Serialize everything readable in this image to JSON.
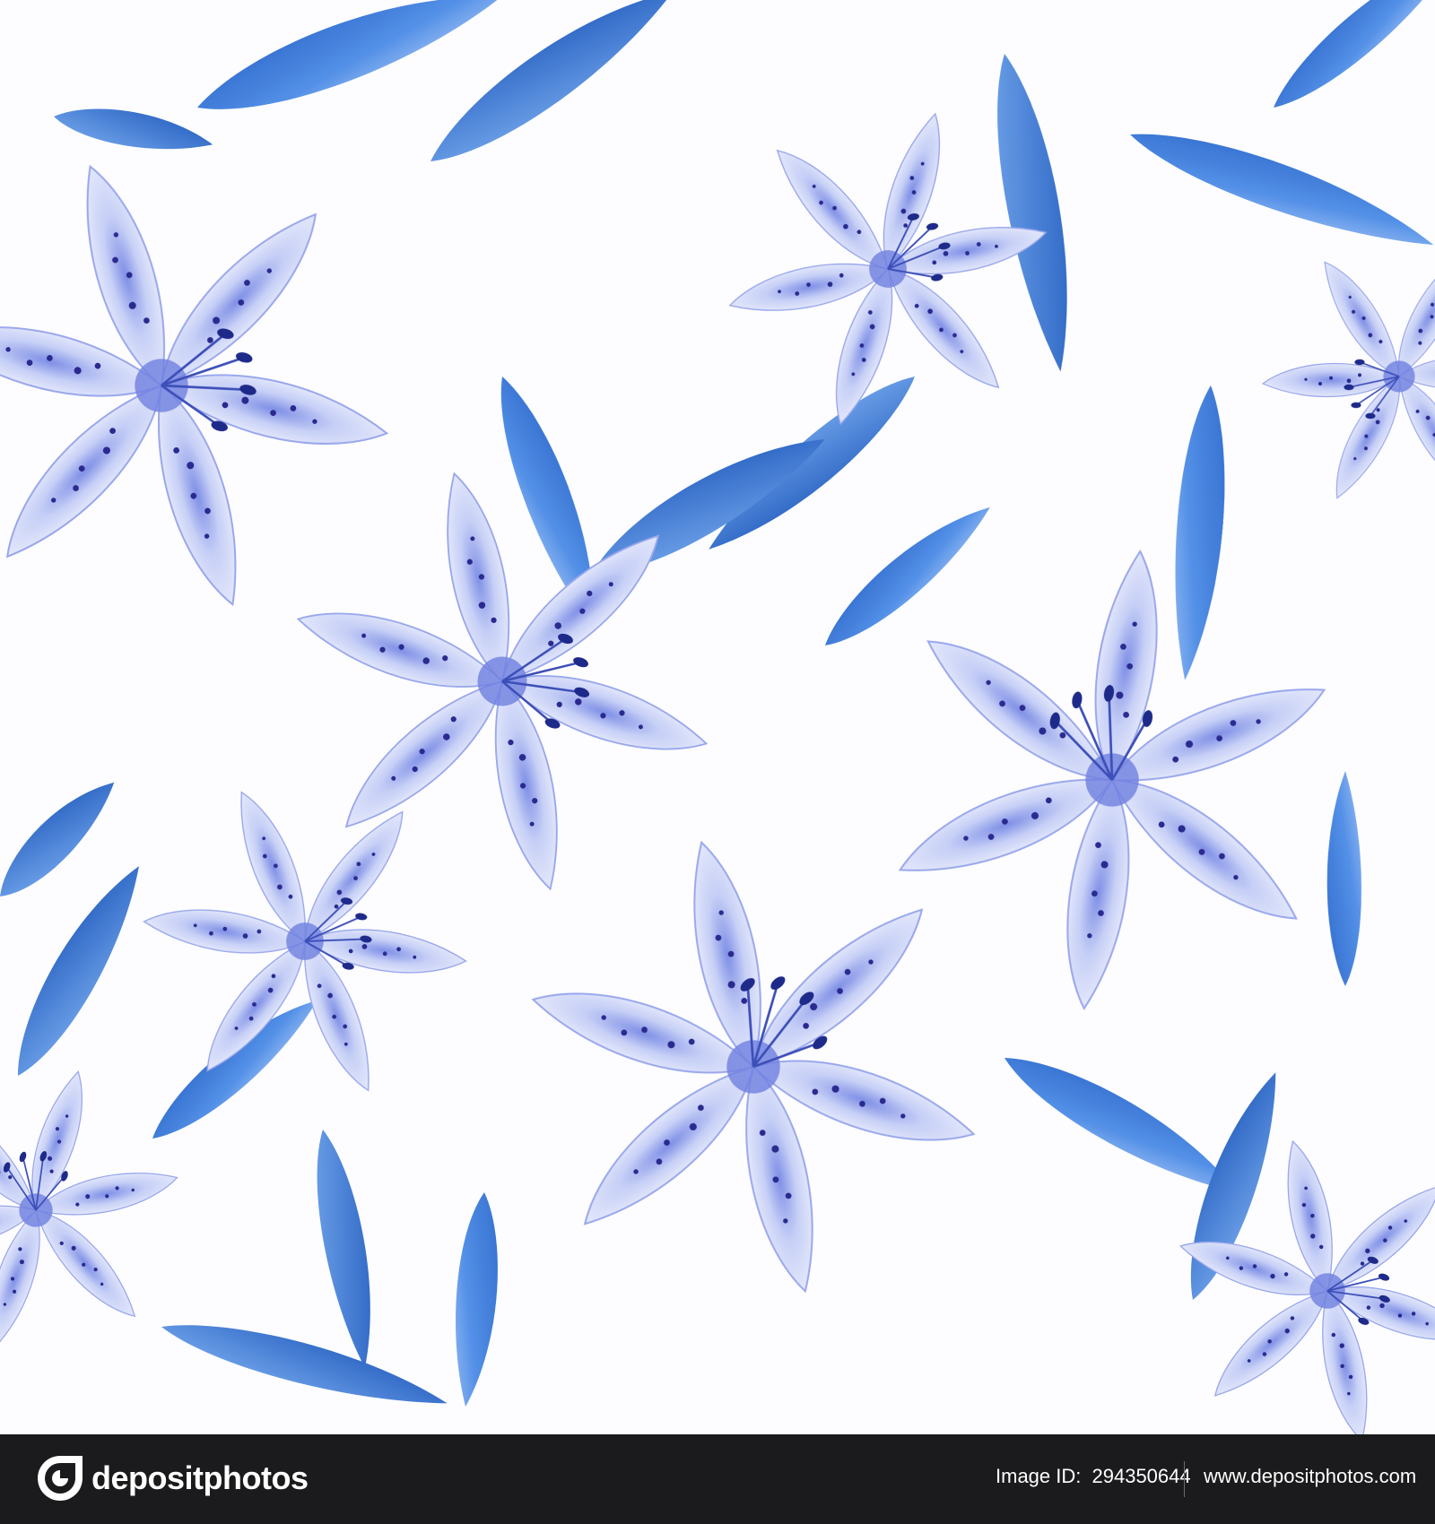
{
  "artwork": {
    "description_icon": "blue-watercolor-lily-pattern",
    "colors": {
      "background": "#fdfdff",
      "leaf_dark": "#1f5fc4",
      "leaf_mid": "#3d7fe0",
      "petal_light": "#dfe5fb",
      "petal_mid": "#a9b6ee",
      "spots": "#2a2a8f"
    }
  },
  "footer": {
    "brand": "depositphotos",
    "image_id_label": "Image ID:",
    "image_id_value": "294350644",
    "site_url": "www.depositphotos.com",
    "background": "#1b1b1d"
  }
}
